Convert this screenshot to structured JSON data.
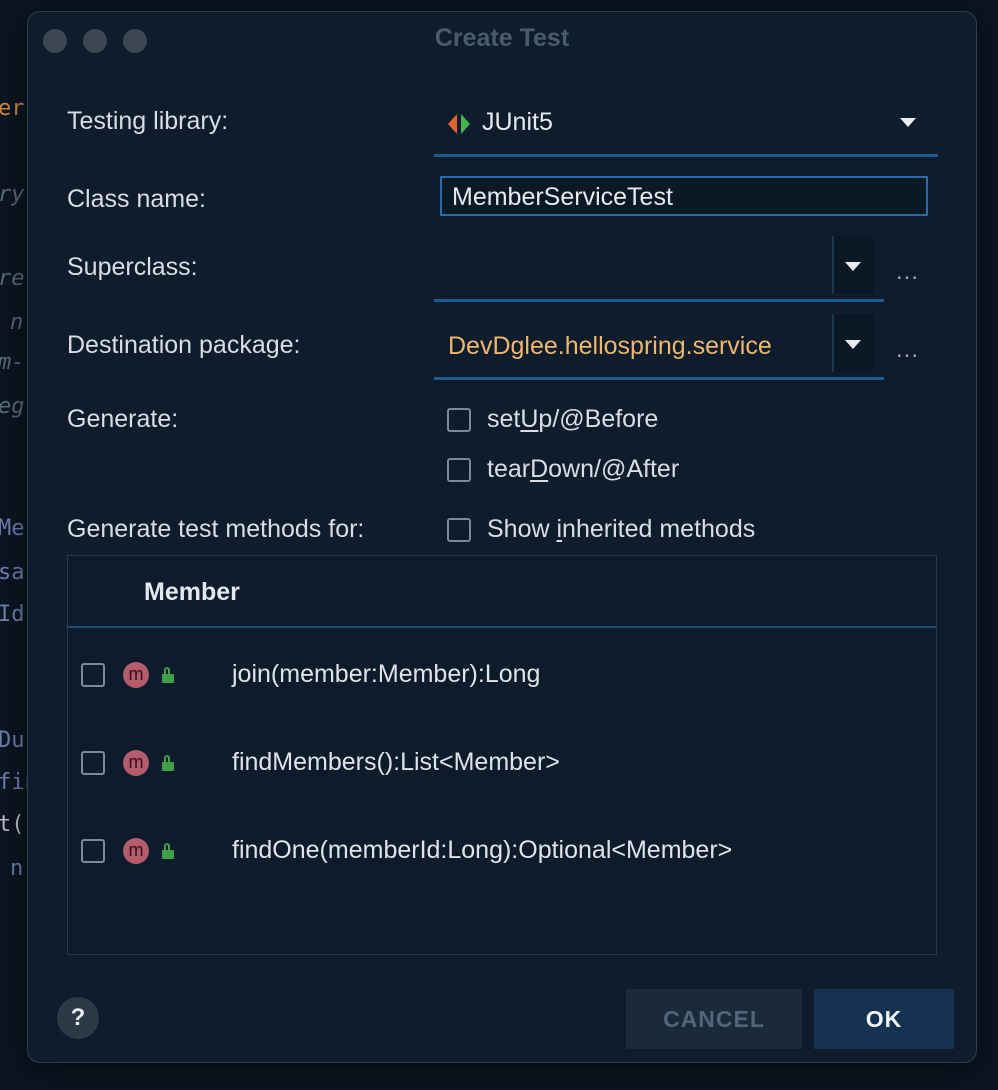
{
  "window": {
    "title": "Create Test"
  },
  "form": {
    "testing_library_label": "Testing library:",
    "testing_library_value": "JUnit5",
    "class_name_label": "Class name:",
    "class_name_value": "MemberServiceTest",
    "superclass_label": "Superclass:",
    "superclass_value": "",
    "destination_label": "Destination package:",
    "destination_value": "DevDglee.hellospring.service",
    "browse_dots": "...",
    "generate_label": "Generate:",
    "setup_pre": "set",
    "setup_u": "U",
    "setup_post": "p/@Before",
    "teardown_pre": "tear",
    "teardown_u": "D",
    "teardown_post": "own/@After",
    "methods_for_label": "Generate test methods for:",
    "inherited_pre": "Show ",
    "inherited_u": "i",
    "inherited_post": "nherited methods"
  },
  "table": {
    "header": "Member",
    "method_badge": "m",
    "rows": [
      {
        "signature": "join(member:Member):Long"
      },
      {
        "signature": "findMembers():List<Member>"
      },
      {
        "signature": "findOne(memberId:Long):Optional<Member>"
      }
    ]
  },
  "footer": {
    "help": "?",
    "cancel": "CANCEL",
    "ok": "OK"
  },
  "background_code": [
    "er",
    "ry",
    "re",
    "n",
    "m-",
    "eg",
    "Me",
    "sa",
    "Id",
    "Du",
    "fin",
    "t(",
    "n"
  ],
  "colors": {
    "dialog_bg": "#0e1c2c",
    "accent_blue": "#1f5b93",
    "package_text": "#f0b66b",
    "method_badge": "#b55d6d",
    "lock_green": "#3fa047",
    "junit_orange": "#e0632e",
    "junit_green": "#44b54a"
  }
}
